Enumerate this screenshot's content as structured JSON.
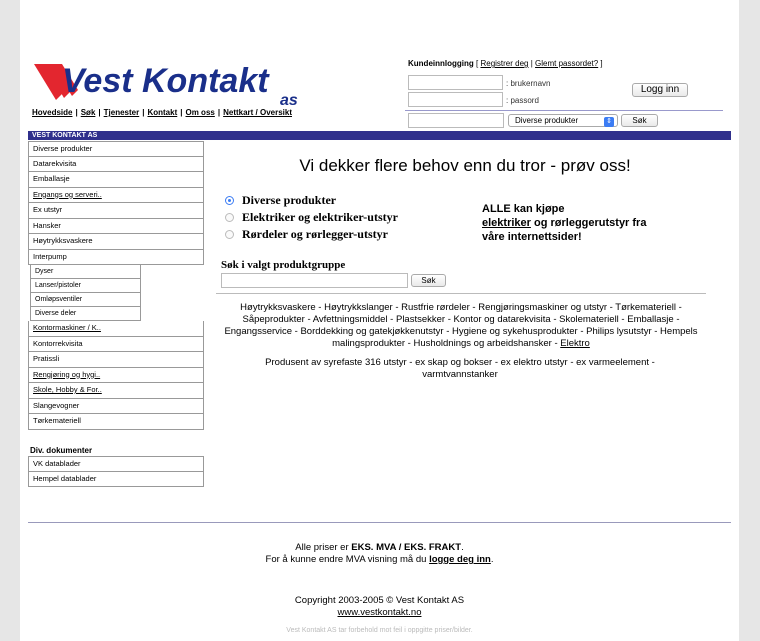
{
  "brand": {
    "logo_text": "Vest Kontakt",
    "logo_suffix": "as",
    "logo_colors": {
      "red": "#e3262f",
      "blue": "#1a2f8a"
    }
  },
  "topnav": [
    "Hovedside",
    "Søk",
    "Tjenester",
    "Kontakt",
    "Om oss",
    "Nettkart / Oversikt"
  ],
  "login": {
    "title": "Kundeinnlogging",
    "register": "Registrer deg",
    "forgot": "Glemt passordet?",
    "username_label": ": brukernavn",
    "password_label": ": passord",
    "button": "Logg inn"
  },
  "topsearch": {
    "select_value": "Diverse produkter",
    "button": "Søk"
  },
  "bluebar": {
    "label": "VEST KONTAKT AS"
  },
  "sidebar": {
    "items_a": [
      {
        "label": "Diverse produkter",
        "ul": false
      },
      {
        "label": "Datarekvisita",
        "ul": false
      },
      {
        "label": "Emballasje",
        "ul": false
      },
      {
        "label": "Engangs og serveri..",
        "ul": true
      },
      {
        "label": "Ex utstyr",
        "ul": false
      },
      {
        "label": "Hansker",
        "ul": false
      },
      {
        "label": "Høytrykksvaskere",
        "ul": false
      },
      {
        "label": "Interpump",
        "ul": false
      }
    ],
    "sub_items": [
      "Dyser",
      "Lanser/pistoler",
      "Omløpsventiler",
      "Diverse deler"
    ],
    "items_b": [
      {
        "label": "Kontormaskiner / K..",
        "ul": true
      },
      {
        "label": "Kontorrekvisita",
        "ul": false
      },
      {
        "label": "Pratissli",
        "ul": false
      },
      {
        "label": "Rengjøring og hygi..",
        "ul": true
      },
      {
        "label": "Skole, Hobby & For..",
        "ul": true
      },
      {
        "label": "Slangevogner",
        "ul": false
      },
      {
        "label": "Tørkemateriell",
        "ul": false
      }
    ],
    "docs_heading": "Div. dokumenter",
    "docs": [
      "VK datablader",
      "Hempel datablader"
    ]
  },
  "main": {
    "headline": "Vi dekker flere behov enn du tror - prøv oss!",
    "radios": [
      {
        "label": "Diverse produkter",
        "checked": true
      },
      {
        "label": "Elektriker og elektriker-utstyr",
        "checked": false
      },
      {
        "label": "Rørdeler og rørlegger-utstyr",
        "checked": false
      }
    ],
    "promo_1": "ALLE kan kjøpe",
    "promo_link": "elektriker",
    "promo_2": " og rørleggerutstyr fra våre internettsider!",
    "search_heading": "Søk i valgt produktgruppe",
    "search_button": "Søk",
    "categories": "Høytrykksvaskere - Høytrykkslanger - Rustfrie rørdeler - Rengjøringsmaskiner og utstyr - Tørkemateriell - Såpeprodukter - Avfettningsmiddel - Plastsekker - Kontor og datarekvisita - Skolemateriell - Emballasje - Engangsservice - Borddekking og gatekjøkkenutstyr - Hygiene og sykehusprodukter - Philips lysutstyr - Hempels malingsprodukter - Husholdnings og arbeidshansker - ",
    "categories_link": "Elektro",
    "produsent": "Produsent av syrefaste 316 utstyr - ex skap og bokser - ex elektro utstyr - ex varmeelement - varmtvannstanker"
  },
  "footer": {
    "prices_pre": "Alle priser er ",
    "prices_bold": "EKS. MVA / EKS. FRAKT",
    "prices_post": ".",
    "mva_pre": "For å kunne endre MVA visning må du ",
    "mva_link": "logge deg inn",
    "mva_post": ".",
    "copyright": "Copyright 2003-2005 © Vest Kontakt AS",
    "site": "www.vestkontakt.no",
    "disclaimer": "Vest Kontakt AS tar forbehold mot feil i oppgitte priser/bilder."
  }
}
